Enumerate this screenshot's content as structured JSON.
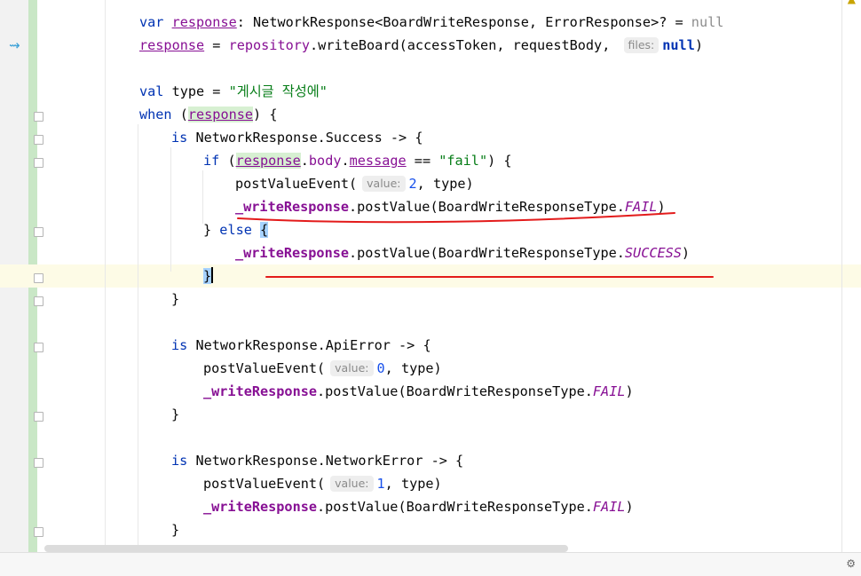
{
  "code": {
    "line1": {
      "kw_var": "var",
      "name": "response",
      "type": ": NetworkResponse<BoardWriteResponse, ErrorResponse>? = ",
      "null": "null"
    },
    "line2": {
      "name": "response",
      "eq": " = ",
      "repo": "repository",
      "call": ".writeBoard(accessToken, requestBody, ",
      "hint": "files:",
      "null": "null",
      ")": ")"
    },
    "line3": {
      "kw": "val",
      "rest": " type = ",
      "str": "\"게시글 작성에\""
    },
    "line4": {
      "kw": "when",
      "open": " (",
      "name": "response",
      "close": ") {"
    },
    "line5": {
      "kw": "is",
      "rest": " NetworkResponse.Success -> {"
    },
    "line6": {
      "kw": "if",
      "open": " (",
      "name": "response",
      "dot1": ".",
      "body": "body",
      "dot2": ".",
      "message": "message",
      "eq": " == ",
      "str": "\"fail\"",
      "close": ") {"
    },
    "line7": {
      "fn": "postValueEvent(",
      "hint": "value:",
      "num": "2",
      "rest": ", type)"
    },
    "line8": {
      "prop": "_writeResponse",
      "call": ".postValue(BoardWriteResponseType.",
      "enum": "FAIL",
      "close": ")"
    },
    "line9": {
      "pre": "} ",
      "kw": "else",
      "space": " ",
      "brace": "{"
    },
    "line10": {
      "prop": "_writeResponse",
      "call": ".postValue(BoardWriteResponseType.",
      "enum": "SUCCESS",
      "close": ")"
    },
    "line11": {
      "brace": "}"
    },
    "line12": {
      "brace": "}"
    },
    "line13": {
      "kw": "is",
      "rest": " NetworkResponse.ApiError -> {"
    },
    "line14": {
      "fn": "postValueEvent(",
      "hint": "value:",
      "num": "0",
      "rest": ", type)"
    },
    "line15": {
      "prop": "_writeResponse",
      "call": ".postValue(BoardWriteResponseType.",
      "enum": "FAIL",
      "close": ")"
    },
    "line16": {
      "brace": "}"
    },
    "line17": {
      "kw": "is",
      "rest": " NetworkResponse.NetworkError -> {"
    },
    "line18": {
      "fn": "postValueEvent(",
      "hint": "value:",
      "num": "1",
      "rest": ", type)"
    },
    "line19": {
      "prop": "_writeResponse",
      "call": ".postValue(BoardWriteResponseType.",
      "enum": "FAIL",
      "close": ")"
    },
    "line20": {
      "brace": "}"
    }
  },
  "icons": {
    "gutter": "run-arrow-icon",
    "warning": "warning-icon",
    "settings": "gear-icon"
  },
  "colors": {
    "keyword": "#0033b3",
    "string": "#067d17",
    "number": "#1750eb",
    "property": "#871094",
    "annotation": "#e31b1b",
    "current_line": "#fdfbe6"
  }
}
